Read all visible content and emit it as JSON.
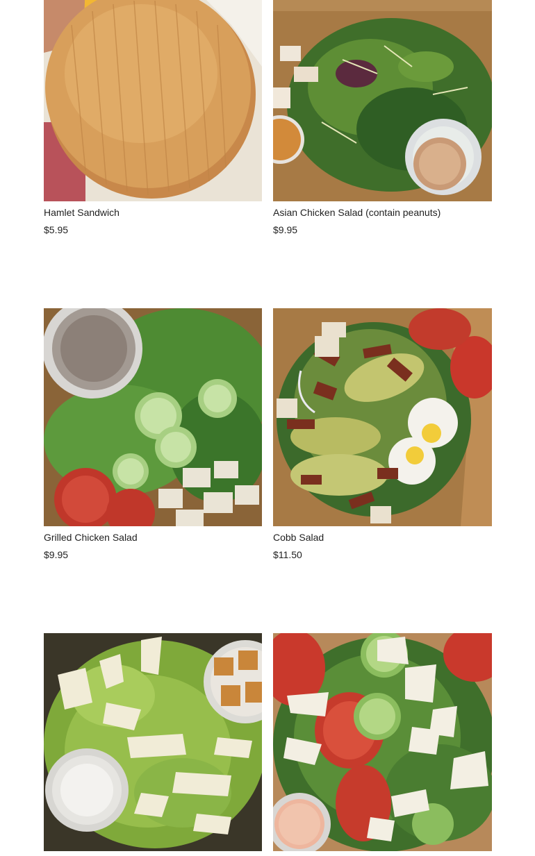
{
  "menu": {
    "items": [
      {
        "name": "Hamlet Sandwich",
        "price": "$5.95",
        "image_icon": "sandwich-image"
      },
      {
        "name": "Asian Chicken Salad (contain peanuts)",
        "price": "$9.95",
        "image_icon": "asian-chicken-salad-image"
      },
      {
        "name": "Grilled Chicken Salad",
        "price": "$9.95",
        "image_icon": "grilled-chicken-salad-image"
      },
      {
        "name": "Cobb Salad",
        "price": "$11.50",
        "image_icon": "cobb-salad-image"
      },
      {
        "name": "",
        "price": "",
        "image_icon": "caesar-salad-image"
      },
      {
        "name": "",
        "price": "",
        "image_icon": "garden-salad-image"
      }
    ]
  },
  "colors": {
    "text": "#1f1f1f",
    "background": "#ffffff",
    "box_kraft": "#a77a45",
    "greens": "#3f7a2e",
    "bun": "#d49a52"
  }
}
